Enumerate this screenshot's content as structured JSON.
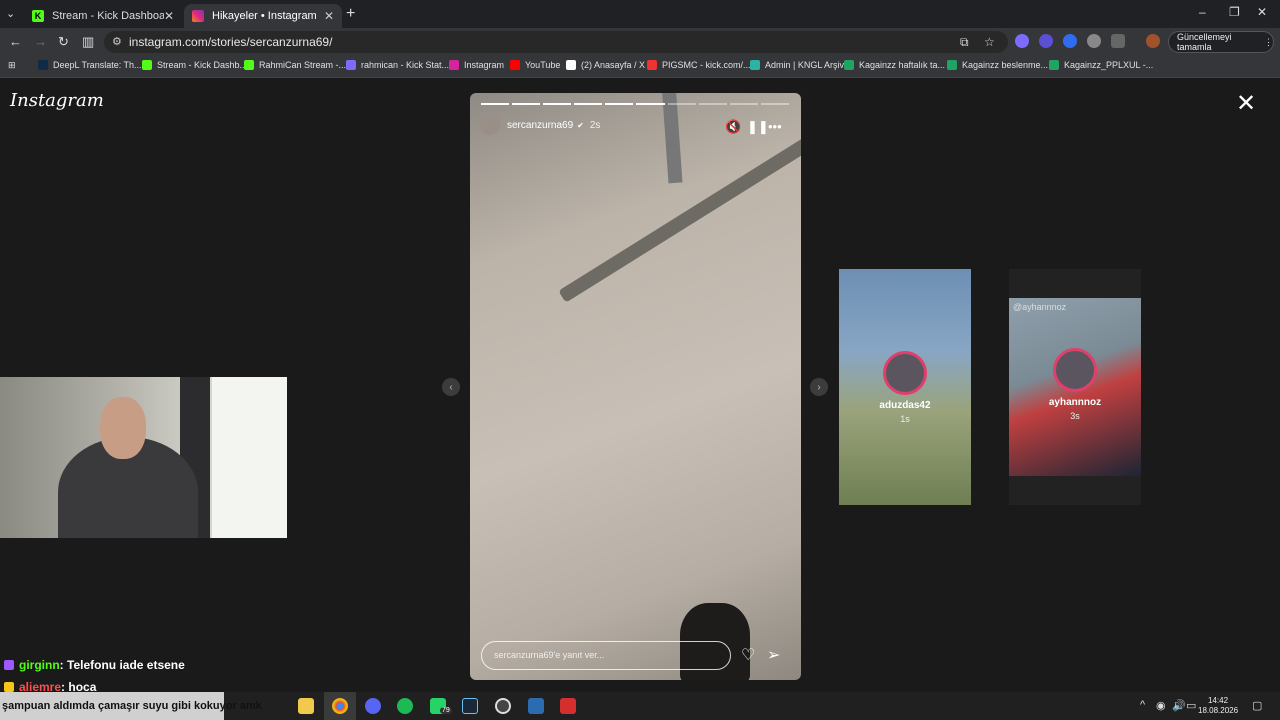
{
  "browser": {
    "tabs": [
      {
        "title": "Stream - Kick Dashboard",
        "active": false,
        "favicon_color": "#53fc18"
      },
      {
        "title": "Hikayeler • Instagram",
        "active": true,
        "favicon_color": "#d6249f"
      }
    ],
    "url": "instagram.com/stories/sercanzurna69/",
    "update_button": "Güncellemeyi tamamla",
    "bookmarks": [
      {
        "label": "DeepL Translate: Th...",
        "color": "#0f2b46"
      },
      {
        "label": "Stream - Kick Dashb...",
        "color": "#53fc18"
      },
      {
        "label": "RahmiCan Stream -...",
        "color": "#53fc18"
      },
      {
        "label": "rahmican - Kick Stat...",
        "color": "#7b6cff"
      },
      {
        "label": "Instagram",
        "color": "#d6249f"
      },
      {
        "label": "YouTube",
        "color": "#ff0000"
      },
      {
        "label": "(2) Anasayfa / X",
        "color": "#ffffff"
      },
      {
        "label": "PIGSMC - kick.com/...",
        "color": "#e33"
      },
      {
        "label": "Admin | KNGL Arşiv",
        "color": "#2bb3a3"
      },
      {
        "label": "Kagainzz haftalık ta...",
        "color": "#1fa463"
      },
      {
        "label": "Kagainzz beslenme...",
        "color": "#1fa463"
      },
      {
        "label": "Kagainzz_PPLXUL -...",
        "color": "#1fa463"
      }
    ]
  },
  "instagram": {
    "logo": "Instagram",
    "story": {
      "username": "sercanzurna69",
      "time": "2s",
      "segments_total": 10,
      "segments_done": 6,
      "reply_placeholder": "sercanzurna69'e yanıt ver..."
    },
    "previews": [
      {
        "username": "aduzdas42",
        "time": "1s",
        "tag": ""
      },
      {
        "username": "ayhannnoz",
        "time": "3s",
        "tag": "@ayhannnoz"
      }
    ]
  },
  "chat": [
    {
      "user": "girginn",
      "message": ": Telefonu iade etsene",
      "badge_color": "#9b59ff",
      "user_color": "#53fc18"
    },
    {
      "user": "aliemre",
      "message": ": hoca",
      "badge_color": "#f5c518",
      "user_color": "#ff4d4d"
    }
  ],
  "taskbar": {
    "marquee": "şampuan aldımda çamaşır suyu gibi kokuyor amk",
    "whatsapp_badge": "79",
    "time": "14:42",
    "date": "18.08.2026"
  }
}
